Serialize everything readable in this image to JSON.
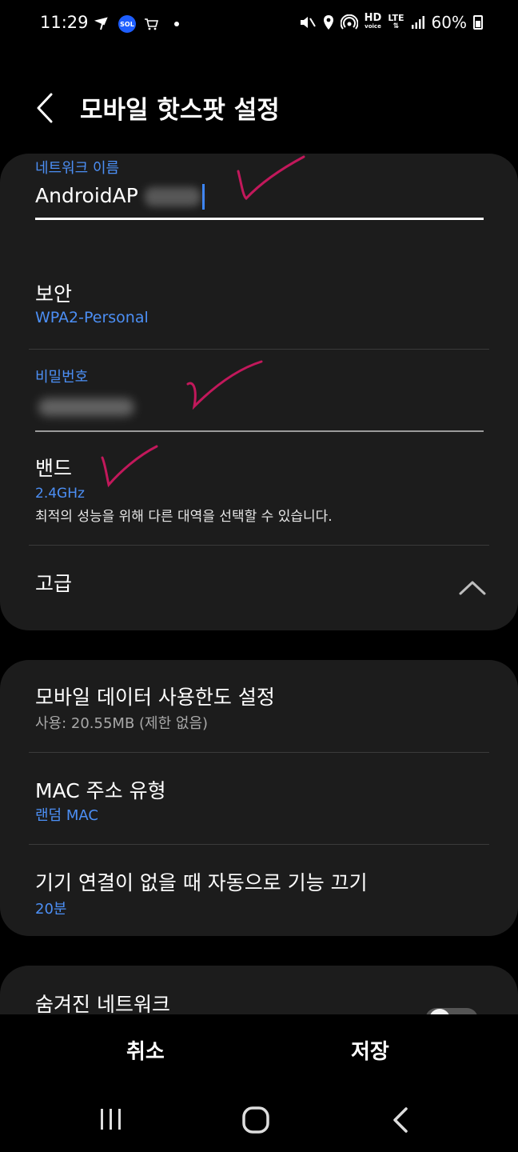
{
  "status_bar": {
    "time": "11:29",
    "sol_label": "SOL",
    "hd_label": "HD",
    "voice_label": "voice",
    "lte_label": "LTE",
    "battery": "60%"
  },
  "header": {
    "title": "모바일 핫스팟 설정"
  },
  "network_name": {
    "label": "네트워크 이름",
    "value": "AndroidAP",
    "value_redacted_suffix": "sjebg"
  },
  "security": {
    "title": "보안",
    "value": "WPA2-Personal"
  },
  "password": {
    "label": "비밀번호",
    "value_redacted": "z••••••9"
  },
  "band": {
    "title": "밴드",
    "value": "2.4GHz",
    "description": "최적의 성능을 위해 다른 대역을 선택할 수 있습니다."
  },
  "advanced": {
    "title": "고급"
  },
  "data_limit": {
    "title": "모바일 데이터 사용한도 설정",
    "sub": "사용: 20.55MB (제한 없음)"
  },
  "mac": {
    "title": "MAC 주소 유형",
    "value": "랜덤 MAC"
  },
  "auto_off": {
    "title": "기기 연결이 없을 때 자동으로 기능 끄기",
    "value": "20분"
  },
  "hidden_network": {
    "title": "숨겨진 네트워크"
  },
  "actions": {
    "cancel": "취소",
    "save": "저장"
  },
  "colors": {
    "accent_blue": "#4c8ff5",
    "card_bg": "#1c1c1c",
    "check_mark": "#c2185b"
  }
}
